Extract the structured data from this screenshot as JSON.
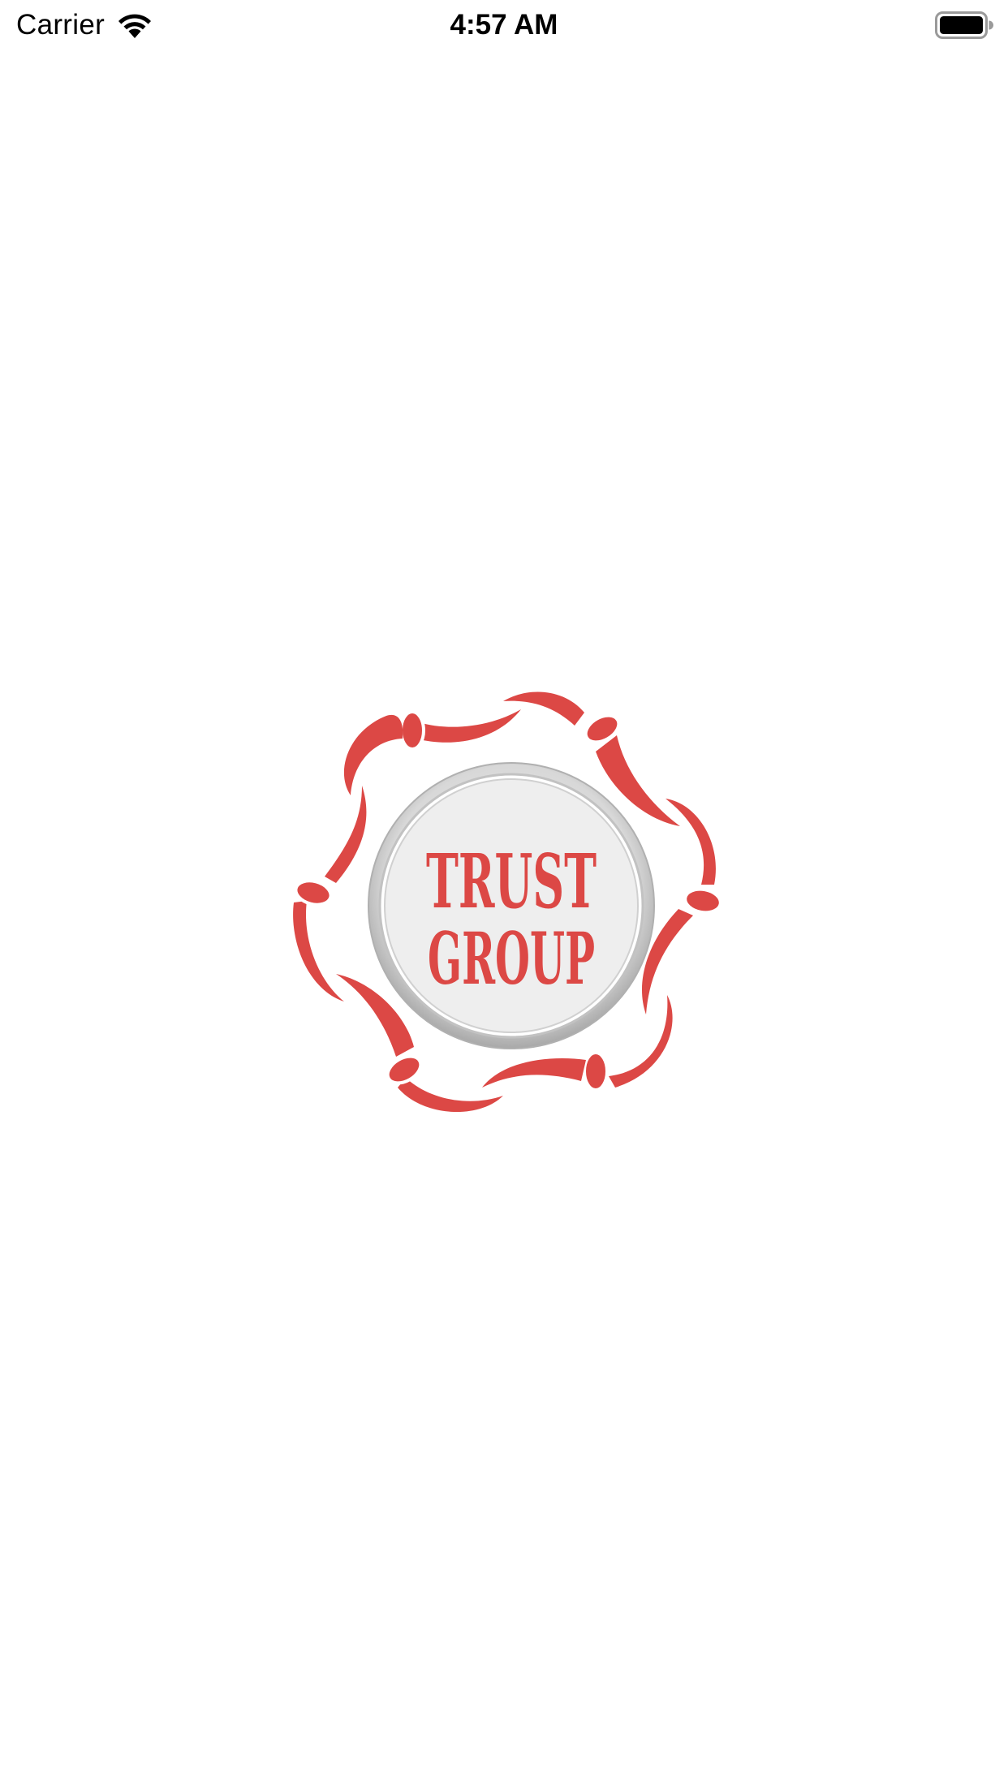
{
  "status_bar": {
    "carrier": "Carrier",
    "time": "4:57 AM",
    "wifi_icon": "wifi-icon",
    "battery_icon": "battery-full-icon"
  },
  "splash": {
    "logo_line1": "TRUST",
    "logo_line2": "GROUP",
    "logo_icon": "trust-group-logo",
    "brand_red": "#dc4845",
    "badge_fill": "#eeeeee",
    "badge_ring": "#bdbdbd"
  }
}
